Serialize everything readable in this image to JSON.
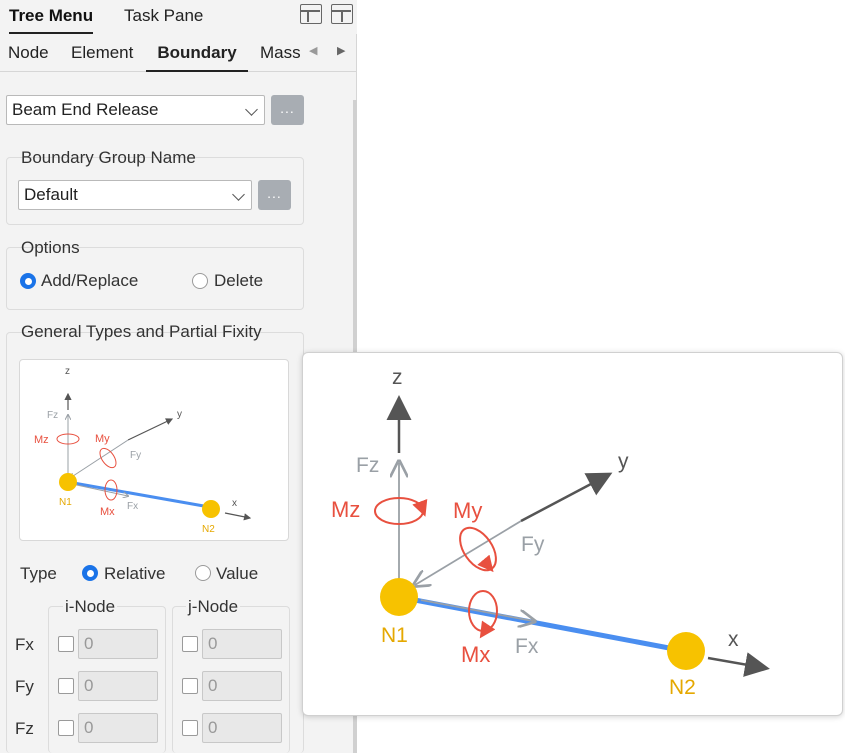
{
  "top_tabs": {
    "tree_menu": "Tree Menu",
    "task_pane": "Task Pane"
  },
  "sub_tabs": {
    "node": "Node",
    "element": "Element",
    "boundary": "Boundary",
    "mass": "Mass"
  },
  "boundary_type": {
    "value": "Beam End Release",
    "more": "..."
  },
  "group_name": {
    "title": "Boundary Group Name",
    "value": "Default",
    "more": "..."
  },
  "options": {
    "title": "Options",
    "add_replace": "Add/Replace",
    "delete": "Delete"
  },
  "general": {
    "title": "General Types and Partial Fixity"
  },
  "type": {
    "label": "Type",
    "relative": "Relative",
    "value": "Value"
  },
  "nodes": {
    "i_node": "i-Node",
    "j_node": "j-Node"
  },
  "rows": [
    {
      "label": "Fx",
      "i": "0",
      "j": "0"
    },
    {
      "label": "Fy",
      "i": "0",
      "j": "0"
    },
    {
      "label": "Fz",
      "i": "0",
      "j": "0"
    }
  ],
  "diagram": {
    "z": "z",
    "y": "y",
    "x": "x",
    "fz": "Fz",
    "fy": "Fy",
    "fx": "Fx",
    "mz": "Mz",
    "my": "My",
    "mx": "Mx",
    "n1": "N1",
    "n2": "N2"
  },
  "colors": {
    "accent": "#1a73e8",
    "moment": "#e8503f",
    "node": "#f7c200",
    "beam": "#4a8ef0",
    "force": "#9aa0a6",
    "axis": "#555555"
  }
}
